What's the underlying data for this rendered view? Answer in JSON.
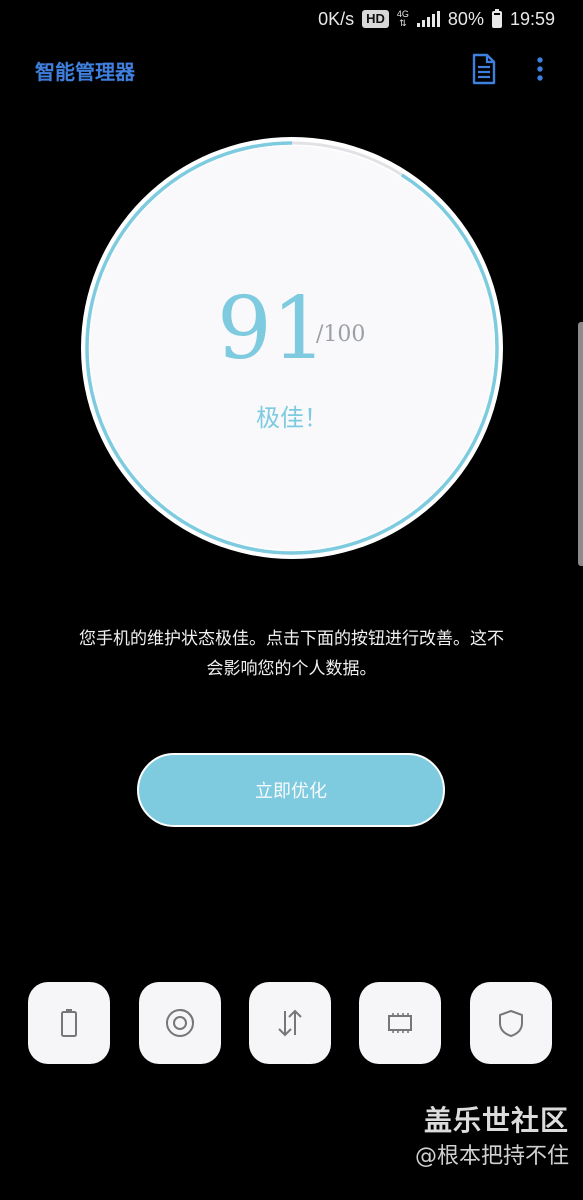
{
  "status_bar": {
    "net_speed": "0K/s",
    "hd_badge": "HD",
    "network_type": "4G",
    "battery_percent": "80%",
    "time": "19:59"
  },
  "app_bar": {
    "title": "智能管理器",
    "title_color": "#3f7fde",
    "icons": [
      "document-icon",
      "more-vert-icon"
    ]
  },
  "score": {
    "value": "91",
    "max": "/100",
    "status": "极佳！",
    "progress_fraction": 0.91,
    "accent_color": "#7ecbe0"
  },
  "description": {
    "line1": "您手机的维护状态极佳。点击下面的按钮进行改善。这不",
    "line2": "会影响您的个人数据。"
  },
  "optimize_button": {
    "label": "立即优化"
  },
  "bottom_tiles": [
    {
      "icon": "battery-icon"
    },
    {
      "icon": "storage-icon"
    },
    {
      "icon": "memory-transfer-icon"
    },
    {
      "icon": "chip-icon"
    },
    {
      "icon": "shield-icon"
    }
  ],
  "watermark": {
    "brand": "盖乐世社区",
    "user": "@根本把持不住"
  }
}
